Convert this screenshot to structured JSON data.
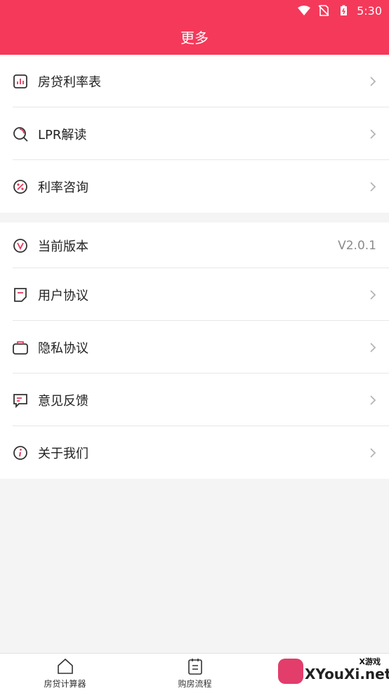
{
  "status_bar": {
    "time": "5:30"
  },
  "header": {
    "title": "更多"
  },
  "menu_group_1": {
    "items": [
      {
        "label": "房贷利率表",
        "icon": "rate-table-icon"
      },
      {
        "label": "LPR解读",
        "icon": "search-icon"
      },
      {
        "label": "利率咨询",
        "icon": "percent-icon"
      }
    ]
  },
  "menu_group_2": {
    "version": {
      "label": "当前版本",
      "value": "V2.0.1",
      "icon": "version-icon"
    },
    "items": [
      {
        "label": "用户协议",
        "icon": "document-icon"
      },
      {
        "label": "隐私协议",
        "icon": "briefcase-icon"
      },
      {
        "label": "意见反馈",
        "icon": "message-icon"
      },
      {
        "label": "关于我们",
        "icon": "info-icon"
      }
    ]
  },
  "bottom_nav": {
    "tabs": [
      {
        "label": "房贷计算器",
        "icon": "home-icon"
      },
      {
        "label": "购房流程",
        "icon": "clipboard-icon"
      }
    ]
  },
  "watermark": {
    "text": "XYouXi.net",
    "small": "X游戏"
  },
  "colors": {
    "accent": "#f5395a",
    "icon_red": "#e2385a"
  }
}
